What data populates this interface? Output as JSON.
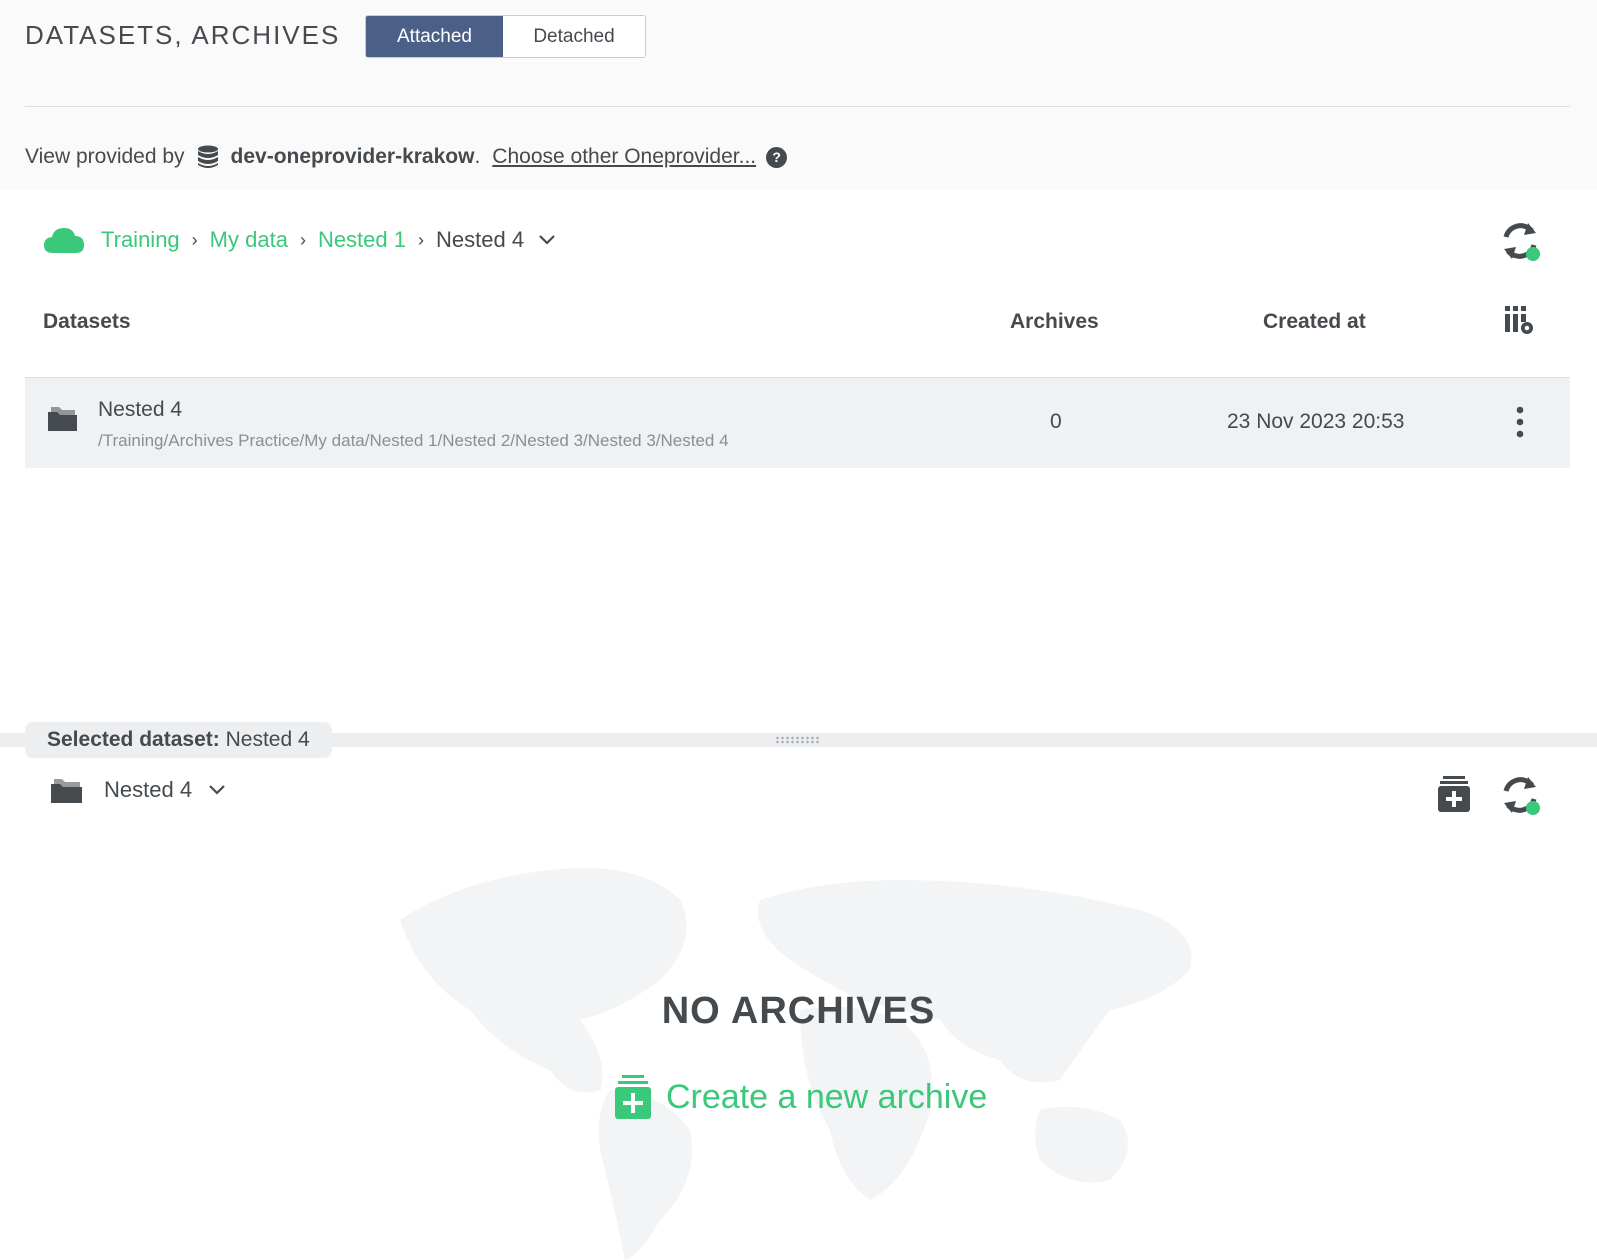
{
  "header": {
    "title": "DATASETS, ARCHIVES",
    "toggle": {
      "attached": "Attached",
      "detached": "Detached",
      "active": "Attached"
    }
  },
  "provider": {
    "prefix": "View provided by",
    "name": "dev-oneprovider-krakow",
    "period": ".",
    "choose": "Choose other Oneprovider...",
    "help": "?"
  },
  "breadcrumb": {
    "items": [
      "Training",
      "My data",
      "Nested 1"
    ],
    "current": "Nested 4",
    "separator": "›"
  },
  "table": {
    "columns": {
      "datasets": "Datasets",
      "archives": "Archives",
      "created": "Created at"
    },
    "rows": [
      {
        "name": "Nested 4",
        "path": "/Training/Archives Practice/My data/Nested 1/Nested 2/Nested 3/Nested 3/Nested 4",
        "archives": "0",
        "created": "23 Nov 2023 20:53"
      }
    ]
  },
  "selected": {
    "label": "Selected dataset:",
    "value": "Nested 4"
  },
  "archives_panel": {
    "dataset": "Nested 4",
    "empty_title": "NO ARCHIVES",
    "create_label": "Create a new archive"
  },
  "colors": {
    "accent": "#3ac87a",
    "primary": "#4a6087",
    "text": "#454a4f",
    "muted": "#8a8f94"
  }
}
